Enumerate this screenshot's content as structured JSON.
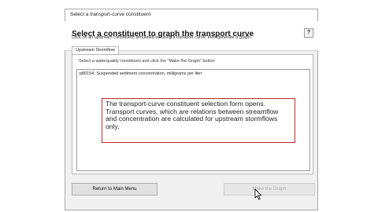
{
  "window": {
    "title": "Select a transport-curve constituent"
  },
  "header": {
    "heading": "Select a constituent to graph the transport curve",
    "help_label": "?"
  },
  "instruction": "Click on an upstream constituent simulated by using a transport curve, then generate a graph",
  "tabs": [
    {
      "label": "Upstream Stormflow"
    }
  ],
  "panel": {
    "instruction": "Select a waterquality constituent and click the \"Make the Graph\" button",
    "list_items": [
      "p80154: Suspended sediment concentration, milligrams per liter"
    ]
  },
  "callout_text": "The transport-curve constituent selection form opens. Transport curves, which are relations between streamflow and concentration are calculated for upstream stormflows only.",
  "buttons": {
    "return_label": "Return to Main Menu",
    "graph_label": "Make the Graph"
  },
  "cursor": "mouse-pointer-icon"
}
